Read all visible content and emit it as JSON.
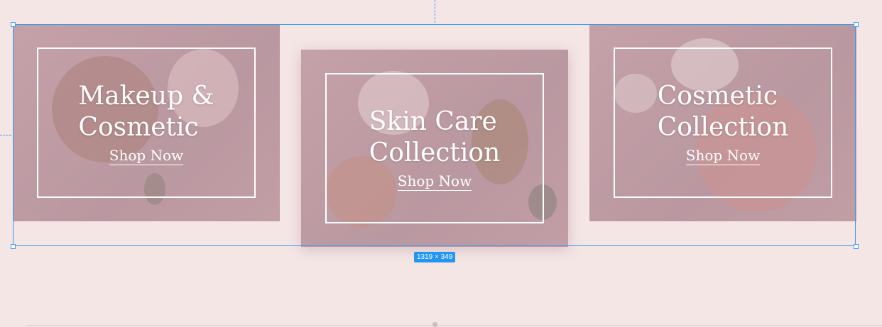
{
  "cards": [
    {
      "title_line1": "Makeup &",
      "title_line2": "Cosmetic",
      "cta": "Shop Now"
    },
    {
      "title_line1": "Skin Care",
      "title_line2": "Collection",
      "cta": "Shop Now"
    },
    {
      "title_line1": "Cosmetic",
      "title_line2": "Collection",
      "cta": "Shop Now"
    }
  ],
  "selection": {
    "size_label": "1319 × 349"
  },
  "colors": {
    "background": "#f5e6e6",
    "selection_accent": "#3b9bf0",
    "badge": "#2196f3",
    "card_overlay": "#c9a7ad"
  }
}
